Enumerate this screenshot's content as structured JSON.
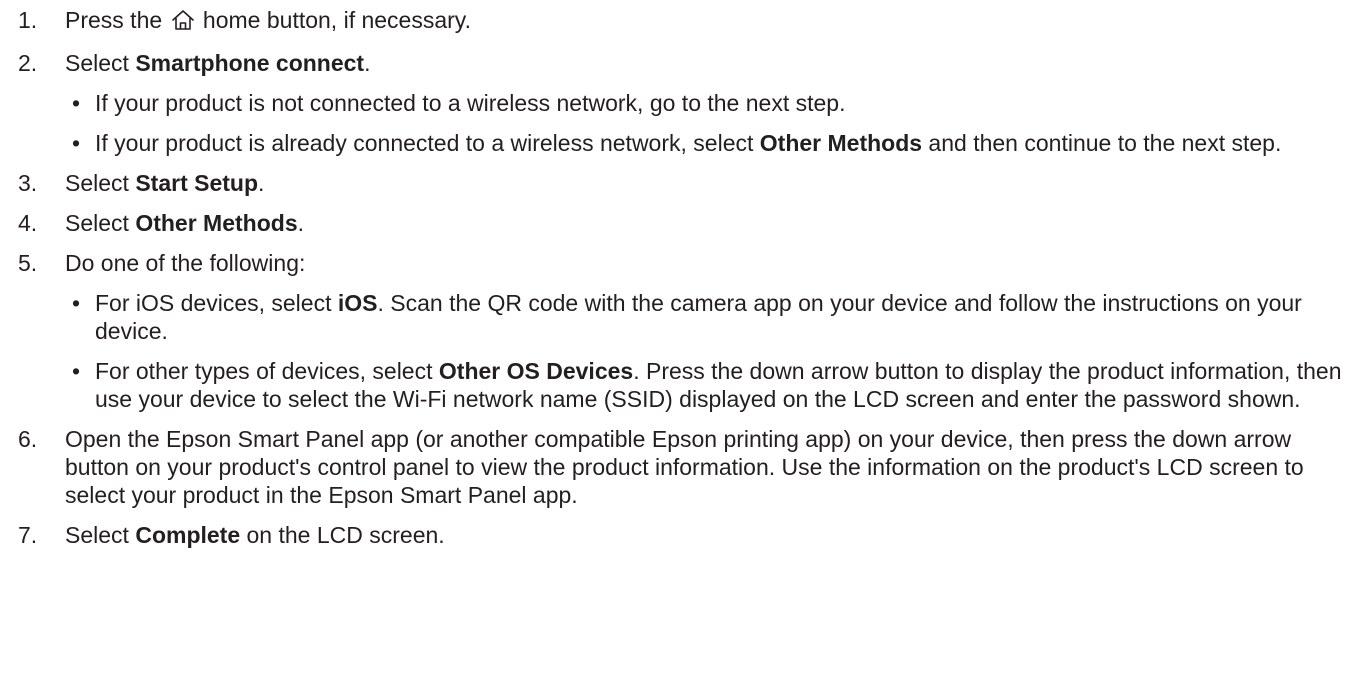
{
  "steps": [
    {
      "number": "1.",
      "before": "Press the ",
      "icon": "home-icon",
      "after": " home button, if necessary."
    },
    {
      "number": "2.",
      "prefix": "Select ",
      "bold": "Smartphone connect",
      "suffix": ".",
      "bullets": [
        {
          "text": "If your product is not connected to a wireless network, go to the next step."
        },
        {
          "prefix": "If your product is already connected to a wireless network, select ",
          "bold": "Other Methods",
          "suffix": " and then continue to the next step."
        }
      ]
    },
    {
      "number": "3.",
      "prefix": "Select ",
      "bold": "Start Setup",
      "suffix": "."
    },
    {
      "number": "4.",
      "prefix": "Select ",
      "bold": "Other Methods",
      "suffix": "."
    },
    {
      "number": "5.",
      "text": "Do one of the following:",
      "bullets": [
        {
          "prefix": "For iOS devices, select ",
          "bold": "iOS",
          "suffix": ". Scan the QR code with the camera app on your device and follow the instructions on your device."
        },
        {
          "prefix": "For other types of devices, select ",
          "bold": "Other OS Devices",
          "suffix": ". Press the down arrow button to display the product information, then use your device to select the Wi-Fi network name (SSID) displayed on the LCD screen and enter the password shown."
        }
      ]
    },
    {
      "number": "6.",
      "text": "Open the Epson Smart Panel app (or another compatible Epson printing app) on your device, then press the down arrow button on your product's control panel to view the product information. Use the information on the product's LCD screen to select your product in the Epson Smart Panel app."
    },
    {
      "number": "7.",
      "prefix": "Select ",
      "bold": "Complete",
      "suffix": " on the LCD screen."
    }
  ],
  "bullet_char": "•"
}
